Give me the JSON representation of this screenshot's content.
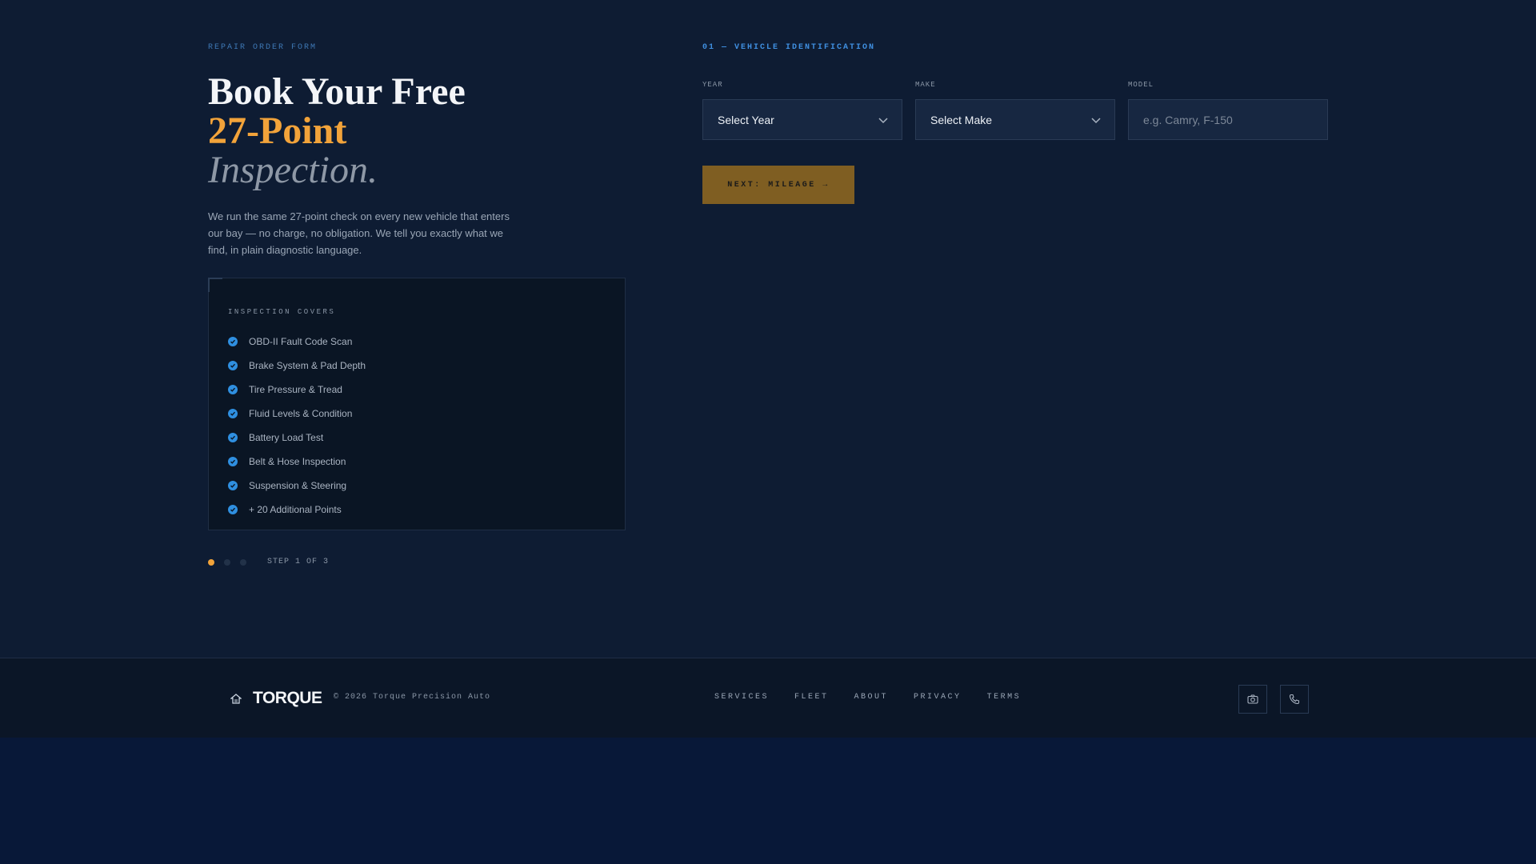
{
  "hero": {
    "eyebrow": "REPAIR ORDER FORM",
    "headline_line1": "Book Your Free",
    "headline_line2": "27-Point",
    "headline_line3": "Inspection.",
    "intro": "We run the same 27-point check on every new vehicle that enters our bay — no charge, no obligation. We tell you exactly what we find, in plain diagnostic language."
  },
  "covers": {
    "title": "INSPECTION COVERS",
    "items": [
      "OBD-II Fault Code Scan",
      "Brake System & Pad Depth",
      "Tire Pressure & Tread",
      "Fluid Levels & Condition",
      "Battery Load Test",
      "Belt & Hose Inspection",
      "Suspension & Steering",
      "+ 20 Additional Points"
    ]
  },
  "stepper": {
    "label": "STEP 1 OF 3",
    "current": 1,
    "total": 3
  },
  "form": {
    "section_label": "01 — VEHICLE IDENTIFICATION",
    "year": {
      "label": "YEAR",
      "value": "Select Year"
    },
    "make": {
      "label": "MAKE",
      "value": "Select Make"
    },
    "model": {
      "label": "MODEL",
      "placeholder": "e.g. Camry, F-150",
      "value": ""
    },
    "next_label": "NEXT: MILEAGE →"
  },
  "footer": {
    "brand": "TORQUE",
    "copyright": "© 2026 Torque Precision Auto",
    "nav": [
      "SERVICES",
      "FLEET",
      "ABOUT",
      "PRIVACY",
      "TERMS"
    ],
    "social_icons": [
      "camera-icon",
      "phone-icon"
    ]
  },
  "colors": {
    "accent": "#f2a33a",
    "primary_blue": "#2f8fe0",
    "background": "#0e1c33"
  }
}
